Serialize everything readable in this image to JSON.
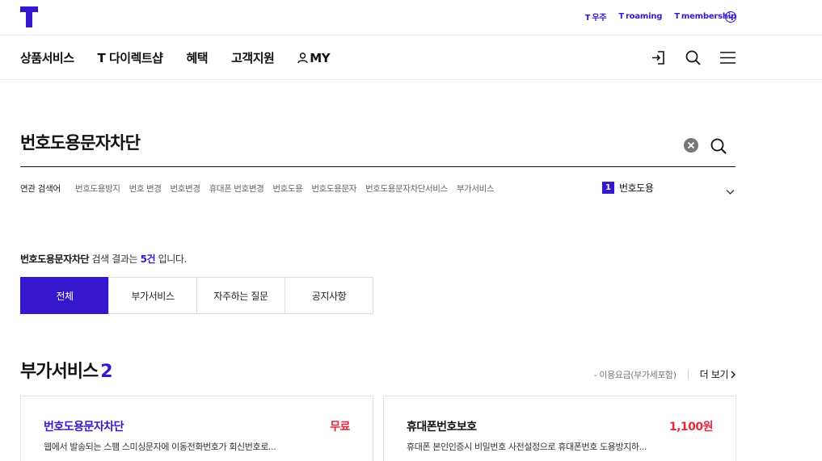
{
  "header": {
    "links": [
      {
        "prefix": "T",
        "label": "우주"
      },
      {
        "prefix": "T",
        "label": "roaming"
      },
      {
        "prefix": "T",
        "label": "membership"
      }
    ]
  },
  "gnb": {
    "menu": [
      "상품서비스",
      "T 다이렉트샵",
      "혜택",
      "고객지원"
    ],
    "my_label": "MY"
  },
  "search": {
    "value": "번호도용문자차단"
  },
  "related": {
    "label": "연관 검색어",
    "keywords": [
      "번호도용방지",
      "번호 변경",
      "번호변경",
      "휴대폰 번호변경",
      "번호도용",
      "번호도용문자",
      "번호도용문자차단서비스",
      "부가서비스"
    ],
    "rank_number": "1",
    "rank_text": "번호도용"
  },
  "result": {
    "query": "번호도용문자차단",
    "mid": " 검색 결과는 ",
    "count": "5건",
    "tail": " 입니다."
  },
  "tabs": [
    "전체",
    "부가서비스",
    "자주하는 질문",
    "공지사항"
  ],
  "section": {
    "title": "부가서비스",
    "count": "2",
    "note": "- 이용요금(부가세포함)",
    "more": "더 보기"
  },
  "cards": [
    {
      "name": "번호도용문자차단",
      "price": "무료",
      "desc": "웹에서 발송되는 스팸 스미싱문자에 이동전화번호가 회신번호로..."
    },
    {
      "name": "휴대폰번호보호",
      "price": "1,100원",
      "desc": "휴대폰 본인인증시 비밀번호 사전설정으로 휴대폰번호 도용방지하..."
    }
  ],
  "colors": {
    "brand": "#3617ce",
    "price": "#e8283f"
  }
}
